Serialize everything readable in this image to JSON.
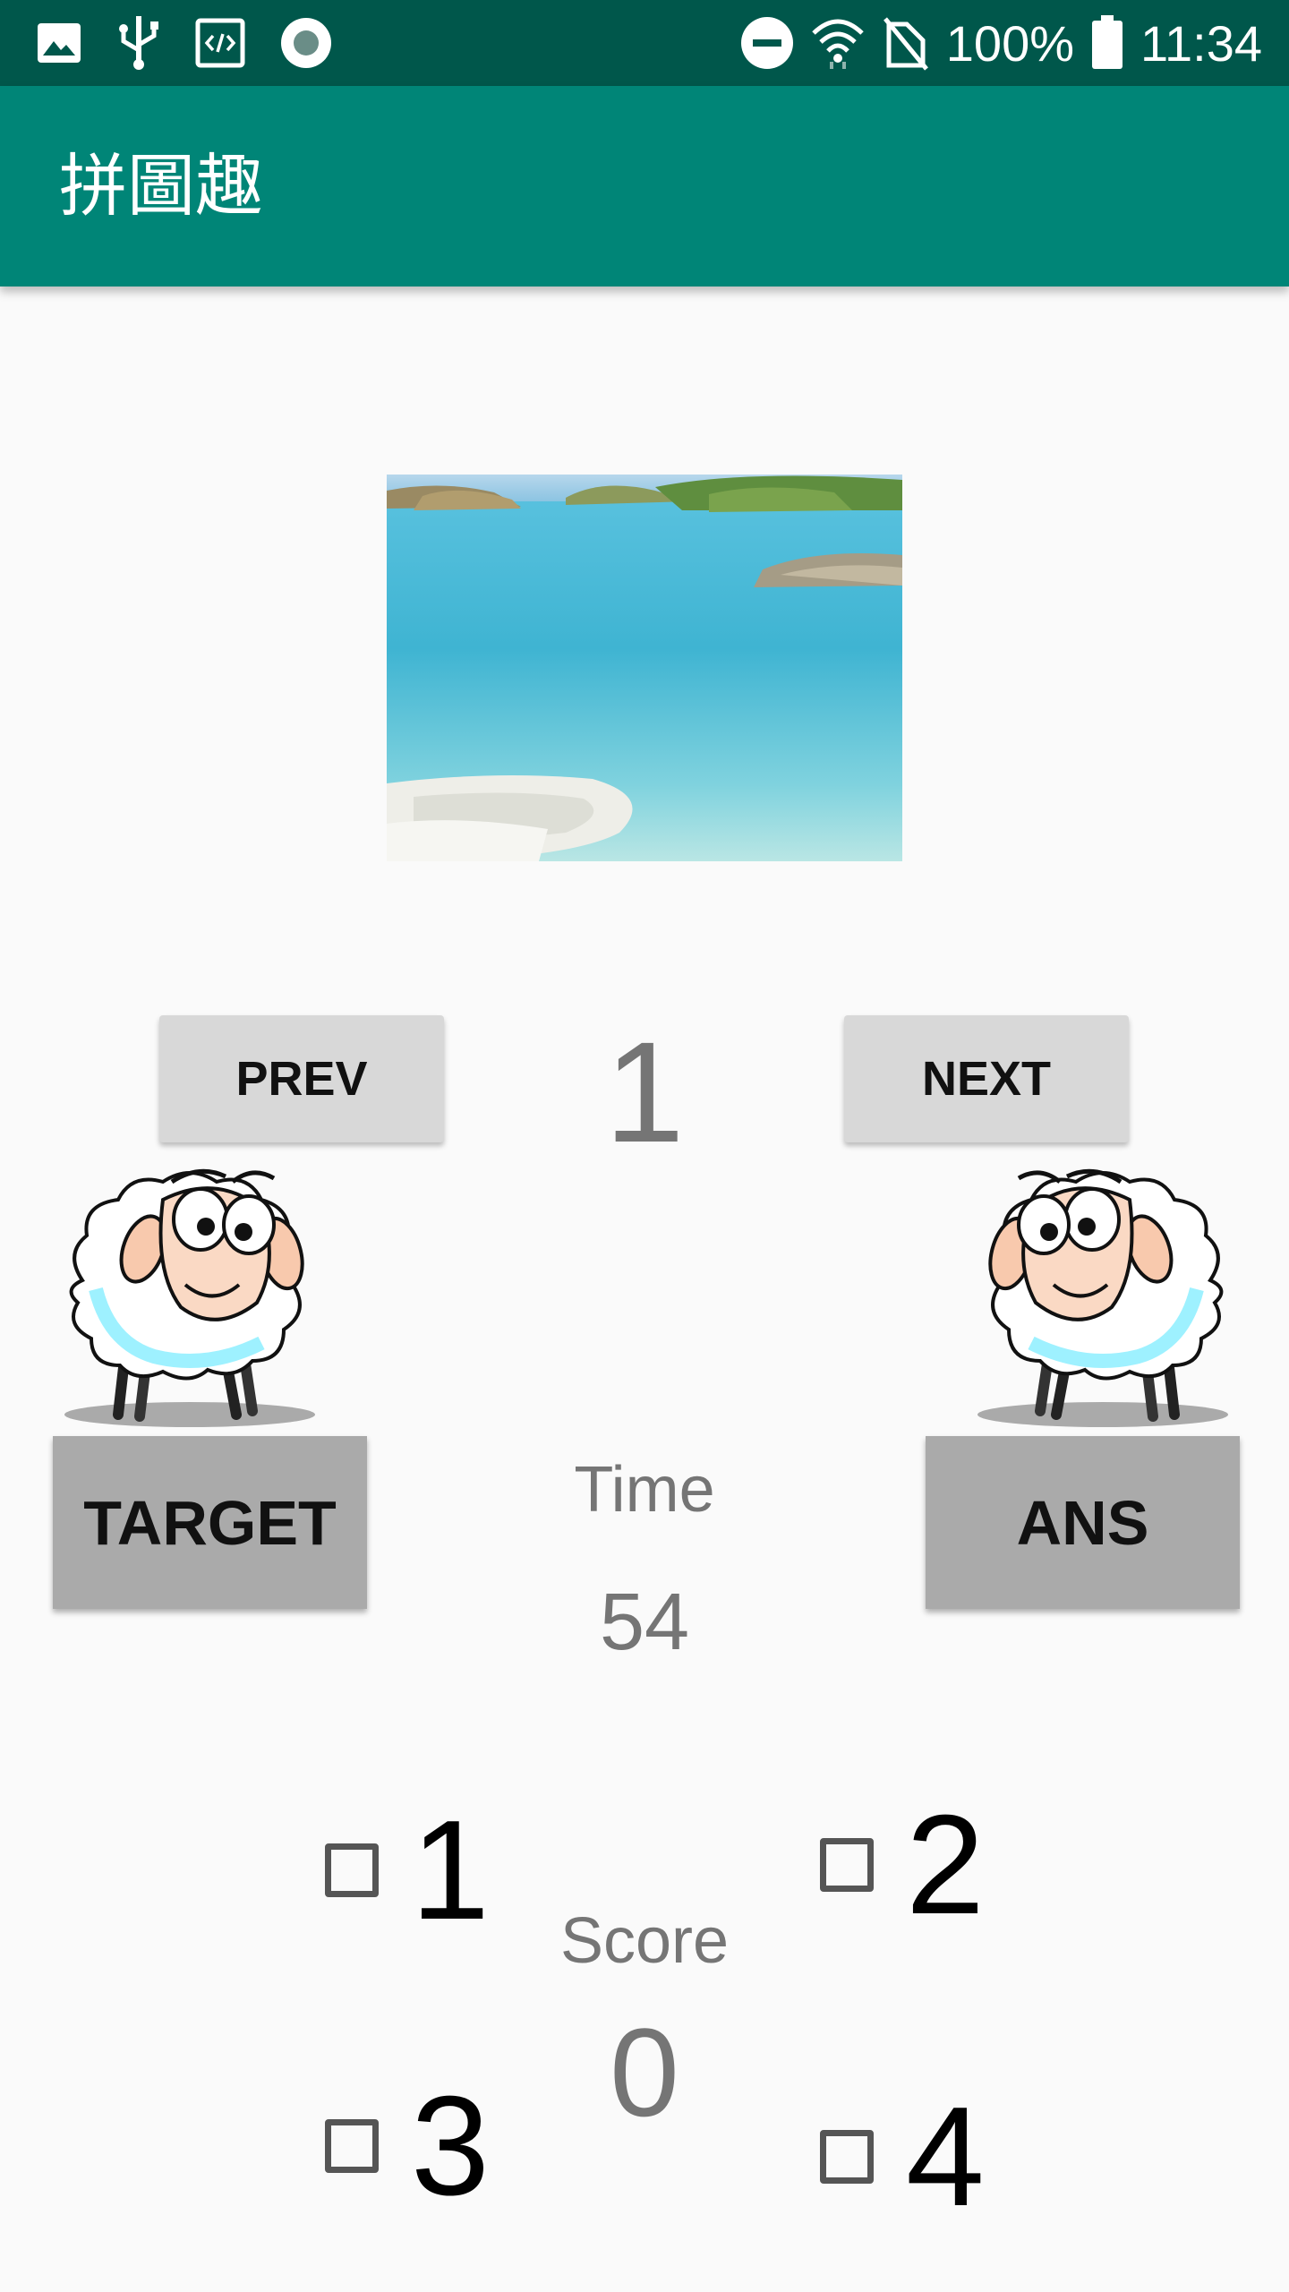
{
  "status_bar": {
    "battery_percent": "100%",
    "time": "11:34",
    "icons": [
      "image-icon",
      "usb-icon",
      "code-icon",
      "record-icon",
      "dnd-icon",
      "wifi-icon",
      "no-sim-icon",
      "battery-icon"
    ]
  },
  "app_bar": {
    "title": "拼圖趣"
  },
  "puzzle": {
    "image_icon": "beach-sea-photo",
    "level": "1",
    "prev_label": "PREV",
    "next_label": "NEXT"
  },
  "actions": {
    "target_label": "TARGET",
    "ans_label": "ANS"
  },
  "timer": {
    "label": "Time",
    "value": "54"
  },
  "score": {
    "label": "Score",
    "value": "0"
  },
  "options": [
    {
      "label": "1",
      "checked": false
    },
    {
      "label": "2",
      "checked": false
    },
    {
      "label": "3",
      "checked": false
    },
    {
      "label": "4",
      "checked": false
    }
  ],
  "colors": {
    "status_bar": "#00574b",
    "app_bar": "#008577",
    "background": "#fafafa",
    "button_light": "#d8d8d8",
    "button_dark": "#aaaaaa",
    "secondary_text": "#757575"
  }
}
